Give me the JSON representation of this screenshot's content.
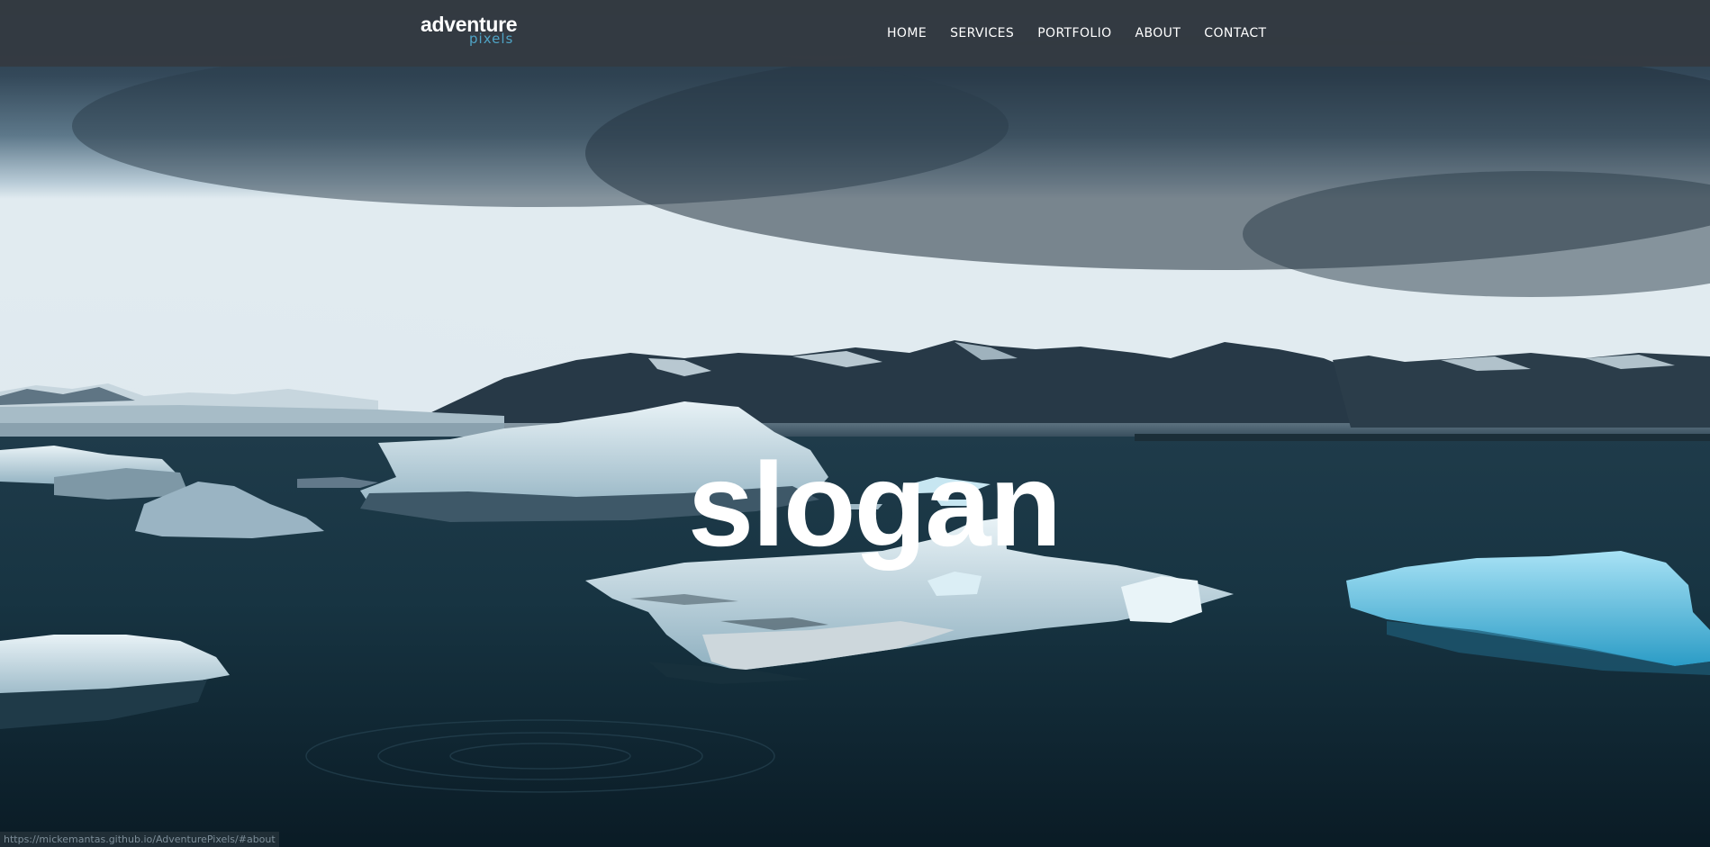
{
  "header": {
    "logo_word": "adventure",
    "logo_sub": "pixels",
    "nav": [
      {
        "label": "HOME"
      },
      {
        "label": "SERVICES"
      },
      {
        "label": "PORTFOLIO"
      },
      {
        "label": "ABOUT"
      },
      {
        "label": "CONTACT"
      }
    ]
  },
  "hero": {
    "slogan": "slogan"
  },
  "status_bar": {
    "url": "https://mickemantas.github.io/AdventurePixels/#about"
  },
  "colors": {
    "navbar_bg": "#343a42",
    "logo_accent": "#4fa3c5",
    "text": "#ffffff"
  }
}
